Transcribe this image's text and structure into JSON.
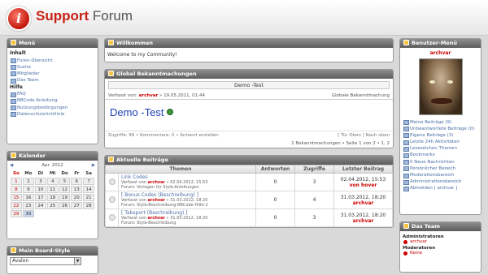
{
  "header": {
    "logo_letter": "i",
    "title_red": "Support",
    "title_gray": " Forum"
  },
  "menu": {
    "title": "Menü",
    "groups": [
      {
        "label": "Inhalt",
        "items": [
          "Foren-Übersicht",
          "Suche",
          "Mitglieder",
          "Das Team"
        ]
      },
      {
        "label": "Hilfe",
        "items": [
          "FAQ",
          "BBCode Anleitung",
          "Nutzungsbedingungen",
          "Datenschutzrichtlinie"
        ]
      }
    ]
  },
  "calendar": {
    "title": "Kalender",
    "prev": "◀",
    "next": "▶",
    "month": "Apr. 2012",
    "days": [
      "So",
      "Mo",
      "Di",
      "Mi",
      "Do",
      "Fr",
      "Sa"
    ],
    "weeks": [
      [
        "1",
        "2",
        "3",
        "4",
        "5",
        "6",
        "7"
      ],
      [
        "8",
        "9",
        "10",
        "11",
        "12",
        "13",
        "14"
      ],
      [
        "15",
        "16",
        "17",
        "18",
        "19",
        "20",
        "21"
      ],
      [
        "22",
        "23",
        "24",
        "25",
        "26",
        "27",
        "28"
      ],
      [
        "29",
        "30",
        "",
        "",
        "",
        "",
        ""
      ]
    ]
  },
  "style_box": {
    "title": "Mein Board-Style",
    "selected": "Avalon"
  },
  "welcome": {
    "title": "Willkommen",
    "text": "Welcome to my Community!"
  },
  "announcements": {
    "title": "Global Bekanntmachungen",
    "topic_title": "Demo -Test",
    "author_prefix": "Verfasst von:",
    "author": "archvar",
    "author_suffix": "» 19.05.2011, 01:44",
    "type": "Globale Bekanntmachung",
    "heading": "Demo -Test",
    "foot_left": "Zugriffe: 99 • Kommentare: 0 • Antwort erstellen",
    "foot_right": "[ Tür Oben ] Nach oben",
    "paging": "2 Bekanntmachungen • Seite 1 von 2 • 1, 2"
  },
  "topics": {
    "title": "Aktuelle Beiträge",
    "columns": [
      "Themen",
      "Antworten",
      "Zugriffe",
      "Letzter Beitrag"
    ],
    "rows": [
      {
        "title": "Link Codes",
        "line1_prefix": "Verfasst von",
        "author": "archvar",
        "line1_suffix": "» 02.04.2012, 15:53",
        "line2": "Forum: Vorlagen für Style-Anleitungen",
        "answers": "0",
        "views": "3",
        "last_date": "02.04.2012, 15:53",
        "last_user": "von hover"
      },
      {
        "title": "[ Bonus Codes (Beschreibung) ]",
        "line1_prefix": "Verfasst von",
        "author": "archvar",
        "line1_suffix": "» 31.03.2012, 18:20",
        "line2": "Forum: Style-Beschreibung-BBCode-Hilfe-2",
        "answers": "0",
        "views": "4",
        "last_date": "31.03.2012, 18:20",
        "last_user": "archvar"
      },
      {
        "title": "[ Tabsport (Beschreibung) ]",
        "line1_prefix": "Verfasst von",
        "author": "archvar",
        "line1_suffix": "» 31.03.2012, 18:20",
        "line2": "Forum: Style-Beschreibung",
        "answers": "0",
        "views": "3",
        "last_date": "31.03.2012, 18:20",
        "last_user": "archvar"
      }
    ]
  },
  "user_menu": {
    "title": "Benutzer-Menü",
    "username": "archvar",
    "links": [
      "Meine Beiträge (9)",
      "Unbeantwortete Beiträge (0)",
      "Eigene Beiträge (3)",
      "Letzte 24h Aktivitäten",
      "Lesezeichen Themen",
      "Bookmarks",
      "0 Neue Nachrichten",
      "Persönlicher Bereich",
      "Moderationsbereich",
      "Administrationsbereich",
      "Abmelden [ archvar ]"
    ]
  },
  "team": {
    "title": "Das Team",
    "groups": [
      {
        "label": "Administratoren",
        "members": [
          "archvar"
        ]
      },
      {
        "label": "Moderatoren",
        "members": [
          "Keine"
        ]
      }
    ]
  }
}
